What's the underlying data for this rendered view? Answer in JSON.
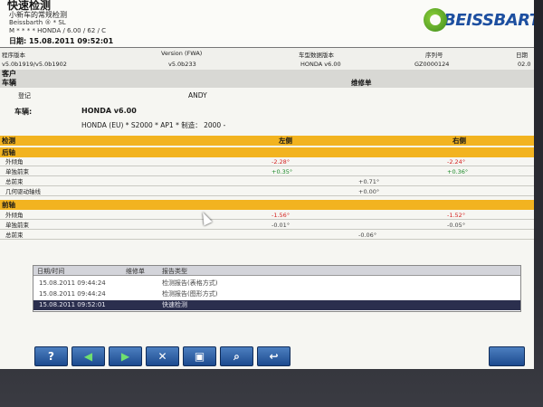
{
  "header": {
    "title": "快速检测",
    "subtitle": "小新车的常规检测",
    "brand_line": "Beissbarth ® * SL",
    "vehicle_line": "M * * * * HONDA / 6.00 / 62 / C",
    "date_line": "日期: 15.08.2011 09:52:01",
    "logo_text": "BEISSBART"
  },
  "version_strip": {
    "program_label": "程序版本",
    "program_value": "v5.0b1919/v5.0b1902",
    "fwa_label": "Version (FWA)",
    "fwa_value": "v5.0b233",
    "db_label": "车型数据版本",
    "db_value": "HONDA v6.00",
    "serial_label": "序列号",
    "serial_value": "GZ0000124",
    "extra_label": "日期",
    "extra_value": "02.0"
  },
  "customer": {
    "section_label": "客户",
    "vehicle_label": "车辆",
    "repair_label": "维修单",
    "register_label": "登记",
    "register_value": "ANDY",
    "vehicle_field_label": "车辆:",
    "vehicle_name": "HONDA v6.00",
    "vehicle_detail": "HONDA (EU) * S2000 * AP1 * 制造： 2000 -"
  },
  "measurements": {
    "header_label": "检测",
    "left_label": "左侧",
    "right_label": "右侧",
    "rear_axle_label": "后轴",
    "front_axle_label": "前轴",
    "rear_rows": [
      {
        "label": "外倾角",
        "left": "-2.28°",
        "left_color": "red",
        "mid": "",
        "right": "-2.24°",
        "right_color": "red"
      },
      {
        "label": "单独前束",
        "left": "+0.35°",
        "left_color": "grn",
        "mid": "",
        "right": "+0.36°",
        "right_color": "grn"
      },
      {
        "label": "总前束",
        "left": "",
        "mid": "+0.71°",
        "mid_color": "gry",
        "right": ""
      },
      {
        "label": "几何驱动轴线",
        "left": "",
        "mid": "+0.00°",
        "mid_color": "gry",
        "right": ""
      }
    ],
    "front_rows": [
      {
        "label": "外倾角",
        "left": "-1.56°",
        "left_color": "red",
        "mid": "",
        "right": "-1.52°",
        "right_color": "red"
      },
      {
        "label": "单独前束",
        "left": "-0.01°",
        "left_color": "gry",
        "mid": "",
        "right": "-0.05°",
        "right_color": "gry"
      },
      {
        "label": "总前束",
        "left": "",
        "mid": "-0.06°",
        "mid_color": "gry",
        "right": ""
      }
    ]
  },
  "history": {
    "col_date": "日期/时间",
    "col_order": "维修单",
    "col_type": "报告类型",
    "rows": [
      {
        "date": "15.08.2011 09:44:24",
        "type": "检测报告(表格方式)",
        "selected": false
      },
      {
        "date": "15.08.2011 09:44:24",
        "type": "检测报告(图形方式)",
        "selected": false
      },
      {
        "date": "15.08.2011 09:52:01",
        "type": "快速检测",
        "selected": true
      }
    ]
  },
  "toolbar": {
    "help": "?",
    "back": "◀",
    "forward": "▶",
    "close": "✕",
    "print": "▣",
    "search": "⌕",
    "return": "↩"
  },
  "colors": {
    "band": "#f2b320",
    "measure_red": "#d42424",
    "measure_green": "#1d8a2a",
    "selection": "#2b2f4e",
    "toolbar_blue": "#1d4b8f"
  }
}
